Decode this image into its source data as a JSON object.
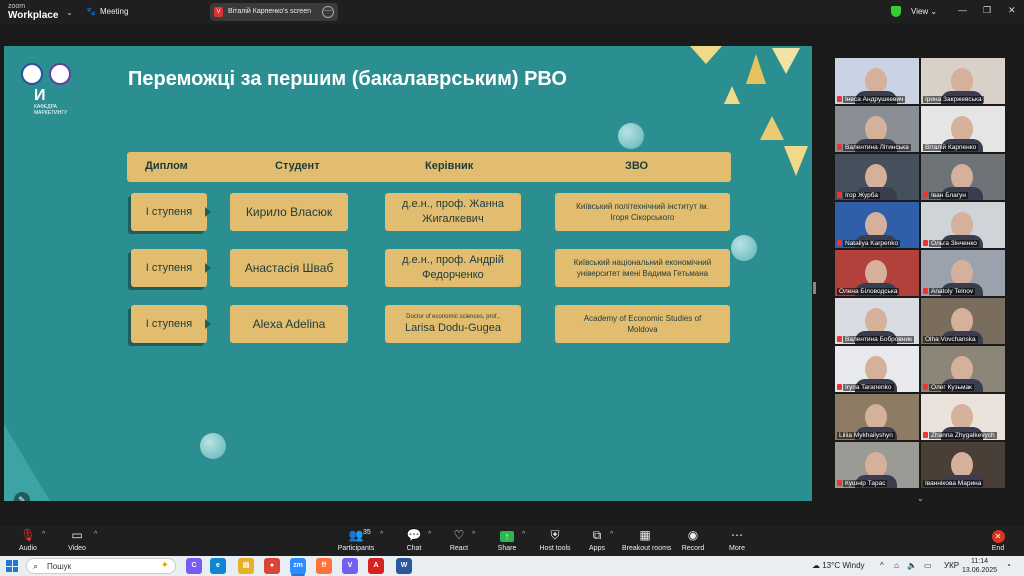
{
  "topbar": {
    "logo_line1": "zoom",
    "logo_line2": "Workplace",
    "meeting_label": "Meeting",
    "share_label": "Віталій Карпенко's screen",
    "share_badge": "V",
    "view_label": "View",
    "window_buttons": [
      "—",
      "❐",
      "✕"
    ]
  },
  "slide": {
    "title": "Переможці за першим (бакалаврським) РВО",
    "dept_caption": "КАФЕДРА МАРКЕТИНГУ",
    "headers": [
      "Диплом",
      "Студент",
      "Керівник",
      "ЗВО"
    ],
    "rows": [
      {
        "degree": "І ступеня",
        "student": "Кирило Власюк",
        "supervisor_lines": [
          "д.е.н., проф. Жанна",
          "Жигалкевич"
        ],
        "supervisor_small": "",
        "university": "Київський політехнічний інститут ім. Ігоря Сікорського"
      },
      {
        "degree": "І ступеня",
        "student": "Анастасія Шваб",
        "supervisor_lines": [
          "д.е.н., проф. Андрій",
          "Федорченко"
        ],
        "supervisor_small": "",
        "university": "Київський національний економічний університет імені Вадима Гетьмана"
      },
      {
        "degree": "І ступеня",
        "student": "Alexa Adelina",
        "supervisor_lines": [
          "Larisa Dodu-Gugea"
        ],
        "supervisor_small": "Doctor of economic sciences, prof.,",
        "university": "Academy of Economic Studies of Moldova"
      }
    ]
  },
  "gallery": {
    "participants": [
      {
        "name": "Інеса Андрушкевич",
        "muted": true,
        "bg": "#c9d3e3"
      },
      {
        "name": "Ірина Закржевська",
        "muted": false,
        "bg": "#d9d0c8"
      },
      {
        "name": "Валентина Літинська",
        "muted": true,
        "bg": "#8a8f95"
      },
      {
        "name": "Віталій Карпенко",
        "muted": false,
        "bg": "#e5e5e5"
      },
      {
        "name": "Ігор Журба",
        "muted": true,
        "bg": "#46505c"
      },
      {
        "name": "Іван Благун",
        "muted": true,
        "bg": "#6e7378"
      },
      {
        "name": "Nataliya Karpenko",
        "muted": true,
        "bg": "#2e5fa8"
      },
      {
        "name": "Ольга Зінченко",
        "muted": true,
        "bg": "#cfd4d8"
      },
      {
        "name": "Олена Біловодська",
        "muted": false,
        "bg": "#b3413b"
      },
      {
        "name": "Anatoly Telnov",
        "muted": true,
        "bg": "#9aa3ad"
      },
      {
        "name": "Валентина Бобровник",
        "muted": true,
        "bg": "#d9dde3"
      },
      {
        "name": "Olha Vovchanska",
        "muted": false,
        "bg": "#7b6d5e"
      },
      {
        "name": "Iryna Taranenko",
        "muted": true,
        "bg": "#e7e9ec"
      },
      {
        "name": "Олег Кузьмак",
        "muted": true,
        "bg": "#8c8678"
      },
      {
        "name": "Liliia Mykhailyshyn",
        "muted": false,
        "bg": "#8e7b63"
      },
      {
        "name": "Zhanna Zhygalkevych",
        "muted": true,
        "bg": "#e9e3dc"
      },
      {
        "name": "Кушнір Тарас",
        "muted": true,
        "bg": "#9c9a95"
      },
      {
        "name": "Іваннікова Марина",
        "muted": false,
        "bg": "#4a3f36"
      }
    ]
  },
  "toolbar": {
    "audio": "Audio",
    "video": "Video",
    "participants": "Participants",
    "participants_count": "35",
    "chat": "Chat",
    "react": "React",
    "share": "Share",
    "host_tools": "Host tools",
    "apps": "Apps",
    "breakout": "Breakout rooms",
    "record": "Record",
    "more": "More",
    "end": "End"
  },
  "taskbar": {
    "search_placeholder": "Пошук",
    "apps": [
      {
        "name": "copilot",
        "label": "C",
        "color": "#7a5cf0"
      },
      {
        "name": "edge",
        "label": "e",
        "color": "#0f86d4"
      },
      {
        "name": "file-explorer",
        "label": "▤",
        "color": "#e6b028"
      },
      {
        "name": "chrome",
        "label": "●",
        "color": "#db4437"
      },
      {
        "name": "zoom",
        "label": "zm",
        "color": "#2d8cff"
      },
      {
        "name": "firefox",
        "label": "ff",
        "color": "#ff7139"
      },
      {
        "name": "viber",
        "label": "V",
        "color": "#7360f2"
      },
      {
        "name": "acrobat",
        "label": "A",
        "color": "#d8201f"
      },
      {
        "name": "word",
        "label": "W",
        "color": "#2b579a"
      }
    ],
    "weather": "13°C  Windy",
    "lang": "УКР",
    "time": "11:14",
    "date": "13.06.2025"
  }
}
